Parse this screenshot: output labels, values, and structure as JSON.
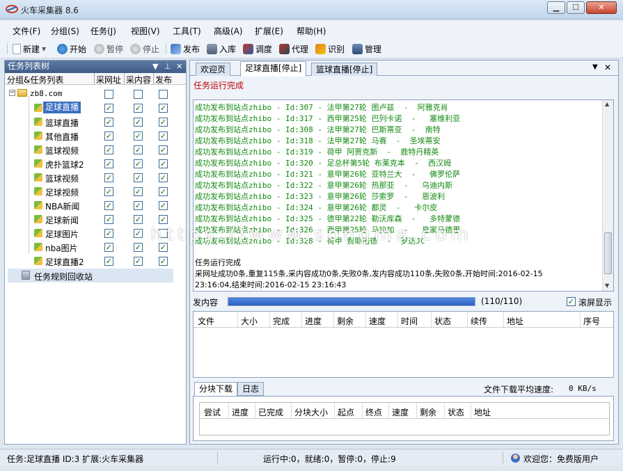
{
  "window": {
    "title": "火车采集器 8.6",
    "min": "▁",
    "max": "☐",
    "close": "✕"
  },
  "menu": [
    "文件(F)",
    "分组(S)",
    "任务(J)",
    "视图(V)",
    "工具(T)",
    "高级(A)",
    "扩展(E)",
    "帮助(H)"
  ],
  "toolbar": {
    "new": "新建",
    "start": "开始",
    "pause": "暂停",
    "stop": "停止",
    "publish": "发布",
    "import": "入库",
    "schedule": "调度",
    "proxy": "代理",
    "recognize": "识别",
    "manage": "管理"
  },
  "left": {
    "title": "任务列表树",
    "ctrls": [
      "▼",
      "⊥",
      "✕"
    ],
    "columns": [
      "分组&任务列表",
      "采网址",
      "采内容",
      "发布"
    ],
    "root": "zb8.com",
    "root_checks": [
      false,
      false,
      false
    ],
    "items": [
      {
        "label": "足球直播",
        "checks": [
          true,
          true,
          true
        ]
      },
      {
        "label": "篮球直播",
        "checks": [
          true,
          true,
          true
        ]
      },
      {
        "label": "其他直播",
        "checks": [
          true,
          true,
          true
        ]
      },
      {
        "label": "篮球视频",
        "checks": [
          true,
          true,
          true
        ]
      },
      {
        "label": "虎扑篮球2",
        "checks": [
          true,
          true,
          true
        ]
      },
      {
        "label": "篮球视频",
        "checks": [
          true,
          true,
          true
        ]
      },
      {
        "label": "足球视频",
        "checks": [
          true,
          true,
          true
        ]
      },
      {
        "label": "NBA新闻",
        "checks": [
          true,
          true,
          true
        ]
      },
      {
        "label": "足球新闻",
        "checks": [
          true,
          true,
          true
        ]
      },
      {
        "label": "足球图片",
        "checks": [
          true,
          true,
          false
        ]
      },
      {
        "label": "nba图片",
        "checks": [
          true,
          true,
          true
        ]
      },
      {
        "label": "足球直播2",
        "checks": [
          true,
          true,
          true
        ]
      }
    ],
    "recycle": "任务规则回收站"
  },
  "tabs": [
    "欢迎页",
    "足球直播[停止]",
    "篮球直播[停止]"
  ],
  "tab_ctrls": [
    "▼",
    "✕"
  ],
  "run_status": "任务运行完成",
  "log": [
    "成功发布到站点zhibo - Id:307 - 法甲第27轮 图卢兹  -  阿雅克肖",
    "成功发布到站点zhibo - Id:317 - 西甲第25轮 巴列卡诺  -   塞维利亚",
    "成功发布到站点zhibo - Id:308 - 法甲第27轮 巴斯蒂亚  -  南特",
    "成功发布到站点zhibo - Id:318 - 法甲第27轮 马赛  -  圣埃蒂安",
    "成功发布到站点zhibo - Id:319 - 荷甲 阿贾克斯  -  鹿特丹精英",
    "成功发布到站点zhibo - Id:320 - 足总杯第5轮 布莱克本  -  西汉姆",
    "成功发布到站点zhibo - Id:321 - 意甲第26轮 亚特兰大  -   佛罗伦萨",
    "成功发布到站点zhibo - Id:322 - 意甲第26轮 热那亚  -   乌迪内斯",
    "成功发布到站点zhibo - Id:323 - 意甲第26轮 莎索罗  -   恩波利",
    "成功发布到站点zhibo - Id:324 - 意甲第26轮 都灵  -   卡尔皮",
    "成功发布到站点zhibo - Id:325 - 德甲第22轮 勒沃库森  -   多特蒙德",
    "成功发布到站点zhibo - Id:326 - 西甲第25轮 马拉加  -   皇家马德里",
    "成功发布到站点zhibo - Id:328 - 荷甲 费耶诺德  -  罗达JC"
  ],
  "log_summary": [
    "任务运行完成",
    "采网址成功0条,重复115条,采内容成功0条,失败0条,发内容成功110条,失败0条,开始时间:2016-02-15",
    "23:16:04,结束时间:2016-02-15 23:16:43"
  ],
  "progress": {
    "label": "发内容",
    "value": 1.0,
    "text": "(110/110)",
    "autoscroll_label": "滚屏显示",
    "autoscroll": true
  },
  "dl_columns": [
    "文件",
    "大小",
    "完成",
    "进度",
    "剩余",
    "速度",
    "时间",
    "状态",
    "续传",
    "地址",
    "序号"
  ],
  "bottom_tabs": [
    "分块下载",
    "日志"
  ],
  "speed": {
    "label": "文件下载平均速度:",
    "value": "0 KB/s"
  },
  "block_columns": [
    "尝试",
    "进度",
    "已完成",
    "分块大小",
    "起点",
    "终点",
    "速度",
    "剩余",
    "状态",
    "地址"
  ],
  "status": {
    "task": "任务:足球直播 ID:3 扩展:火车采集器",
    "run": "运行中:0，就绪:0，暂停:0，停止:9",
    "user": "欢迎您：免费版用户"
  },
  "watermark": "https://www.songma.com"
}
